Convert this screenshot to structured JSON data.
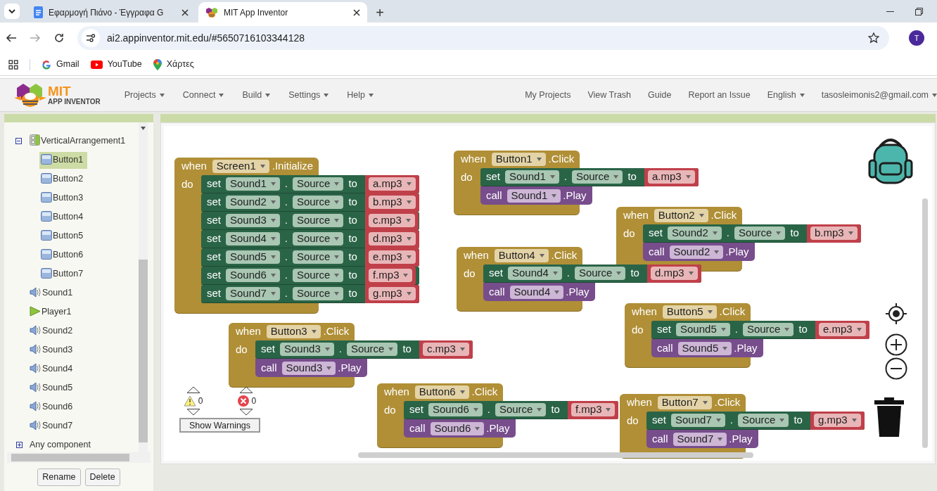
{
  "browser": {
    "tabs": [
      {
        "kind": "docs",
        "title": "Εφαρμογή Πιάνο - Έγγραφα G",
        "selected": false
      },
      {
        "kind": "appinventor",
        "title": "MIT App Inventor",
        "selected": true
      }
    ],
    "new_tab": "+",
    "url": "ai2.appinventor.mit.edu/#5650716103344128",
    "profile": "T",
    "bookmarks": [
      {
        "kind": "gmail",
        "label": "Gmail"
      },
      {
        "kind": "youtube",
        "label": "YouTube"
      },
      {
        "kind": "maps",
        "label": "Χάρτες"
      }
    ]
  },
  "app": {
    "logo": {
      "title": "MIT",
      "subtitle": "APP INVENTOR"
    },
    "menus": [
      {
        "label": "Projects",
        "dropdown": true
      },
      {
        "label": "Connect",
        "dropdown": true
      },
      {
        "label": "Build",
        "dropdown": true
      },
      {
        "label": "Settings",
        "dropdown": true
      },
      {
        "label": "Help",
        "dropdown": true
      }
    ],
    "links": [
      {
        "label": "My Projects",
        "dropdown": false
      },
      {
        "label": "View Trash",
        "dropdown": false
      },
      {
        "label": "Guide",
        "dropdown": false
      },
      {
        "label": "Report an Issue",
        "dropdown": false
      },
      {
        "label": "English",
        "dropdown": true
      },
      {
        "label": "tasosleimonis2@gmail.com",
        "dropdown": true
      }
    ]
  },
  "components": {
    "tree": [
      {
        "kind": "arrangement",
        "name": "VerticalArrangement1",
        "selected": false,
        "expanded": true,
        "children": [
          {
            "kind": "button",
            "name": "Button1",
            "selected": true
          },
          {
            "kind": "button",
            "name": "Button2",
            "selected": false
          },
          {
            "kind": "button",
            "name": "Button3",
            "selected": false
          },
          {
            "kind": "button",
            "name": "Button4",
            "selected": false
          },
          {
            "kind": "button",
            "name": "Button5",
            "selected": false
          },
          {
            "kind": "button",
            "name": "Button6",
            "selected": false
          },
          {
            "kind": "button",
            "name": "Button7",
            "selected": false
          }
        ]
      },
      {
        "kind": "sound",
        "name": "Sound1",
        "selected": false
      },
      {
        "kind": "player",
        "name": "Player1",
        "selected": false
      },
      {
        "kind": "sound",
        "name": "Sound2",
        "selected": false
      },
      {
        "kind": "sound",
        "name": "Sound3",
        "selected": false
      },
      {
        "kind": "sound",
        "name": "Sound4",
        "selected": false
      },
      {
        "kind": "sound",
        "name": "Sound5",
        "selected": false
      },
      {
        "kind": "sound",
        "name": "Sound6",
        "selected": false
      },
      {
        "kind": "sound",
        "name": "Sound7",
        "selected": false
      }
    ],
    "any_component": {
      "label": "Any component",
      "expanded": false
    },
    "buttons": [
      "Rename",
      "Delete"
    ]
  },
  "blocks": [
    {
      "when": "when",
      "component": "Screen1",
      "event": ".Initialize",
      "do": "do",
      "statements": [
        {
          "kind": "set",
          "keyword": "set",
          "component": "Sound1",
          "dot": ".",
          "property": "Source",
          "to": "to",
          "value": "a.mp3"
        },
        {
          "kind": "set",
          "keyword": "set",
          "component": "Sound2",
          "dot": ".",
          "property": "Source",
          "to": "to",
          "value": "b.mp3"
        },
        {
          "kind": "set",
          "keyword": "set",
          "component": "Sound3",
          "dot": ".",
          "property": "Source",
          "to": "to",
          "value": "c.mp3"
        },
        {
          "kind": "set",
          "keyword": "set",
          "component": "Sound4",
          "dot": ".",
          "property": "Source",
          "to": "to",
          "value": "d.mp3"
        },
        {
          "kind": "set",
          "keyword": "set",
          "component": "Sound5",
          "dot": ".",
          "property": "Source",
          "to": "to",
          "value": "e.mp3"
        },
        {
          "kind": "set",
          "keyword": "set",
          "component": "Sound6",
          "dot": ".",
          "property": "Source",
          "to": "to",
          "value": "f.mp3"
        },
        {
          "kind": "set",
          "keyword": "set",
          "component": "Sound7",
          "dot": ".",
          "property": "Source",
          "to": "to",
          "value": "g.mp3"
        }
      ]
    },
    {
      "when": "when",
      "component": "Button1",
      "event": ".Click",
      "do": "do",
      "statements": [
        {
          "kind": "set",
          "keyword": "set",
          "component": "Sound1",
          "dot": ".",
          "property": "Source",
          "to": "to",
          "value": "a.mp3"
        },
        {
          "kind": "call",
          "keyword": "call",
          "component": "Sound1",
          "method": ".Play"
        }
      ]
    },
    {
      "when": "when",
      "component": "Button2",
      "event": ".Click",
      "do": "do",
      "statements": [
        {
          "kind": "set",
          "keyword": "set",
          "component": "Sound2",
          "dot": ".",
          "property": "Source",
          "to": "to",
          "value": "b.mp3"
        },
        {
          "kind": "call",
          "keyword": "call",
          "component": "Sound2",
          "method": ".Play"
        }
      ]
    },
    {
      "when": "when",
      "component": "Button4",
      "event": ".Click",
      "do": "do",
      "statements": [
        {
          "kind": "set",
          "keyword": "set",
          "component": "Sound4",
          "dot": ".",
          "property": "Source",
          "to": "to",
          "value": "d.mp3"
        },
        {
          "kind": "call",
          "keyword": "call",
          "component": "Sound4",
          "method": ".Play"
        }
      ]
    },
    {
      "when": "when",
      "component": "Button5",
      "event": ".Click",
      "do": "do",
      "statements": [
        {
          "kind": "set",
          "keyword": "set",
          "component": "Sound5",
          "dot": ".",
          "property": "Source",
          "to": "to",
          "value": "e.mp3"
        },
        {
          "kind": "call",
          "keyword": "call",
          "component": "Sound5",
          "method": ".Play"
        }
      ]
    },
    {
      "when": "when",
      "component": "Button3",
      "event": ".Click",
      "do": "do",
      "statements": [
        {
          "kind": "set",
          "keyword": "set",
          "component": "Sound3",
          "dot": ".",
          "property": "Source",
          "to": "to",
          "value": "c.mp3"
        },
        {
          "kind": "call",
          "keyword": "call",
          "component": "Sound3",
          "method": ".Play"
        }
      ]
    },
    {
      "when": "when",
      "component": "Button6",
      "event": ".Click",
      "do": "do",
      "statements": [
        {
          "kind": "set",
          "keyword": "set",
          "component": "Sound6",
          "dot": ".",
          "property": "Source",
          "to": "to",
          "value": "f.mp3"
        },
        {
          "kind": "call",
          "keyword": "call",
          "component": "Sound6",
          "method": ".Play"
        }
      ]
    },
    {
      "when": "when",
      "component": "Button7",
      "event": ".Click",
      "do": "do",
      "statements": [
        {
          "kind": "set",
          "keyword": "set",
          "component": "Sound7",
          "dot": ".",
          "property": "Source",
          "to": "to",
          "value": "g.mp3"
        },
        {
          "kind": "call",
          "keyword": "call",
          "component": "Sound7",
          "method": ".Play"
        }
      ]
    }
  ],
  "warnings": {
    "warning_count": "0",
    "error_count": "0",
    "button": "Show Warnings"
  }
}
